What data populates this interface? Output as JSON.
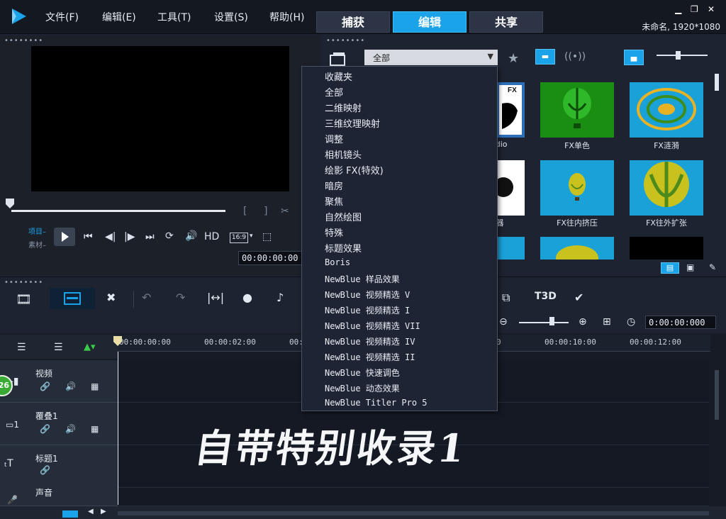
{
  "menu": [
    "文件(F)",
    "编辑(E)",
    "工具(T)",
    "设置(S)",
    "帮助(H)"
  ],
  "modes": [
    {
      "label": "捕获",
      "active": false
    },
    {
      "label": "编辑",
      "active": true
    },
    {
      "label": "共享",
      "active": false
    }
  ],
  "window_controls": {
    "minimize": "▁",
    "restore": "❐",
    "close": "✕"
  },
  "project_info": "未命名, 1920*1080",
  "preview": {
    "mode_project": "项目",
    "mode_clip": "素材",
    "hd_label": "HD",
    "aspect_label": "16:9",
    "timecode": "00:00:00:00"
  },
  "library": {
    "category_selected": "全部",
    "dropdown_options": [
      "收藏夹",
      "全部",
      "二维映射",
      "三维纹理映射",
      "调整",
      "相机镜头",
      "绘影 FX(特效)",
      "暗房",
      "聚焦",
      "自然绘图",
      "特殊",
      "标题效果",
      "Boris",
      "NewBlue 样品效果",
      "NewBlue 视频精选 V",
      "NewBlue 视频精选 I",
      "NewBlue 视频精选 VII",
      "NewBlue 视频精选 IV",
      "NewBlue 视频精选 II",
      "NewBlue 快速调色",
      "NewBlue 动态效果",
      "NewBlue Titler Pro 5"
    ],
    "thumbnails": [
      {
        "label": "Studio"
      },
      {
        "label": "FX单色"
      },
      {
        "label": "FX涟漪"
      },
      {
        "label": "器"
      },
      {
        "label": "FX往内挤压"
      },
      {
        "label": "FX往外扩张"
      }
    ]
  },
  "toolbar": {
    "timecode": "0:00:00:000"
  },
  "ruler": [
    "00:00:00:00",
    "00:00:02:00",
    "00:0",
    "0",
    "00:00:10:00",
    "00:00:12:00"
  ],
  "tracks": [
    {
      "name": "视频"
    },
    {
      "name": "覆叠1"
    },
    {
      "name": "标题1"
    },
    {
      "name": "声音"
    }
  ],
  "watermark": "自带特别收录1",
  "badge": "26",
  "colors": {
    "accent": "#1aa3e8",
    "background": "#1c2230",
    "panel": "#1d2330"
  }
}
